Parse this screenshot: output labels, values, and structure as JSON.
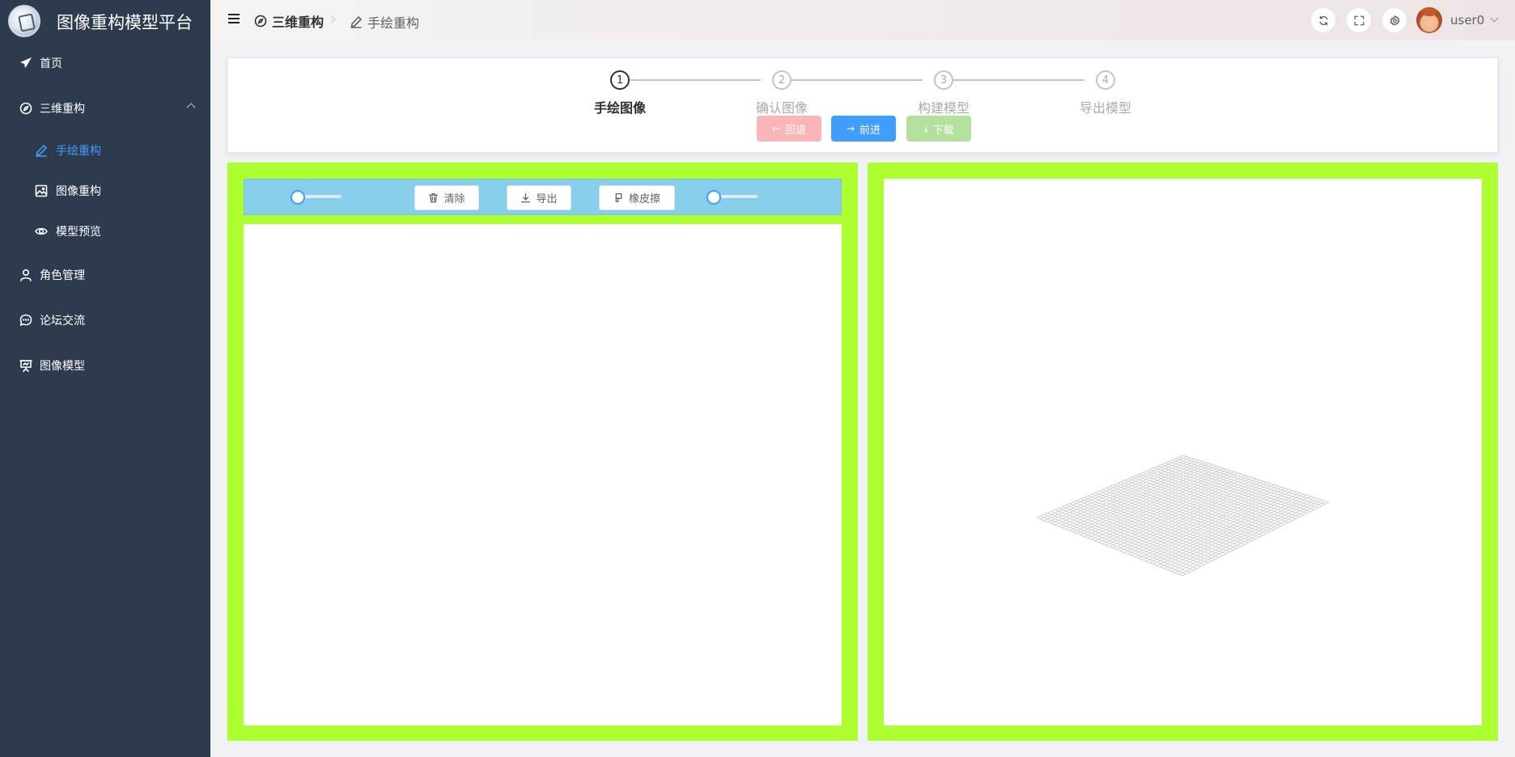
{
  "app": {
    "title": "图像重构模型平台"
  },
  "sidebar": {
    "items": [
      {
        "label": "首页",
        "icon": "paper-plane-icon"
      },
      {
        "label": "三维重构",
        "icon": "compass-icon",
        "expanded": true,
        "children": [
          {
            "label": "手绘重构",
            "icon": "pencil-icon",
            "active": true
          },
          {
            "label": "图像重构",
            "icon": "image-icon"
          },
          {
            "label": "模型预览",
            "icon": "eye-icon"
          }
        ]
      },
      {
        "label": "角色管理",
        "icon": "user-icon"
      },
      {
        "label": "论坛交流",
        "icon": "chat-icon"
      },
      {
        "label": "图像模型",
        "icon": "presentation-icon"
      }
    ]
  },
  "header": {
    "breadcrumb": [
      {
        "label": "三维重构",
        "icon": "compass-icon"
      },
      {
        "label": "手绘重构",
        "icon": "pencil-icon"
      }
    ],
    "icons": [
      "refresh-icon",
      "fullscreen-icon",
      "settings-icon"
    ],
    "user": {
      "name": "user0"
    }
  },
  "steps": {
    "items": [
      {
        "number": "1",
        "title": "手绘图像",
        "state": "active"
      },
      {
        "number": "2",
        "title": "确认图像",
        "state": "wait"
      },
      {
        "number": "3",
        "title": "构建模型",
        "state": "wait"
      },
      {
        "number": "4",
        "title": "导出模型",
        "state": "wait"
      }
    ],
    "buttons": {
      "back": "回退",
      "next": "前进",
      "download": "下载"
    }
  },
  "drawing": {
    "toolbar": {
      "clear": "清除",
      "export": "导出",
      "eraser": "橡皮擦",
      "brush_size_value": 0,
      "eraser_size_value": 0
    }
  },
  "viewer": {
    "grid_divisions": 40,
    "grid_color": "#c8c8c8"
  },
  "colors": {
    "sidebar_bg": "#2e3b4e",
    "accent": "#409eff",
    "panel_bg": "#adff2f",
    "toolbar_bg": "#87ceeb",
    "back_button": "#fab6b6",
    "download_button": "#b3e19d"
  }
}
